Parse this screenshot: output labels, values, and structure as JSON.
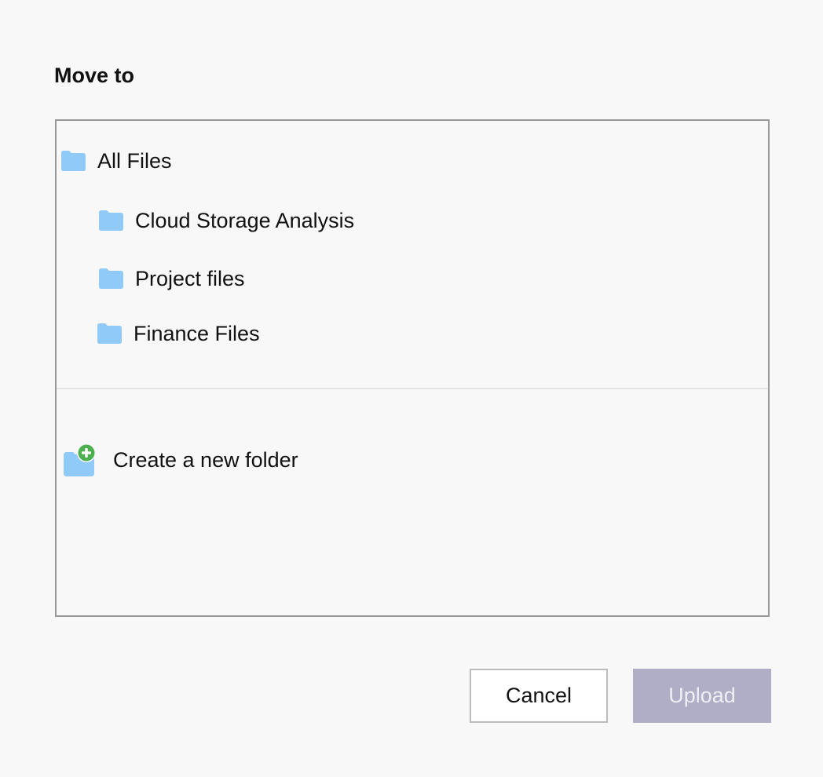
{
  "dialog": {
    "title": "Move to"
  },
  "tree": {
    "root": {
      "label": "All Files",
      "icon": "folder-icon"
    },
    "children": [
      {
        "label": "Cloud Storage Analysis",
        "icon": "folder-icon"
      },
      {
        "label": "Project files",
        "icon": "folder-icon"
      },
      {
        "label": "Finance Files",
        "icon": "folder-icon"
      }
    ],
    "create_label": "Create a new folder",
    "create_icon": "new-folder-icon"
  },
  "buttons": {
    "cancel_label": "Cancel",
    "upload_label": "Upload"
  },
  "colors": {
    "folder": "#90caf9",
    "plus_badge": "#4caf50",
    "upload_bg": "#b0aec7",
    "border": "#999999"
  }
}
